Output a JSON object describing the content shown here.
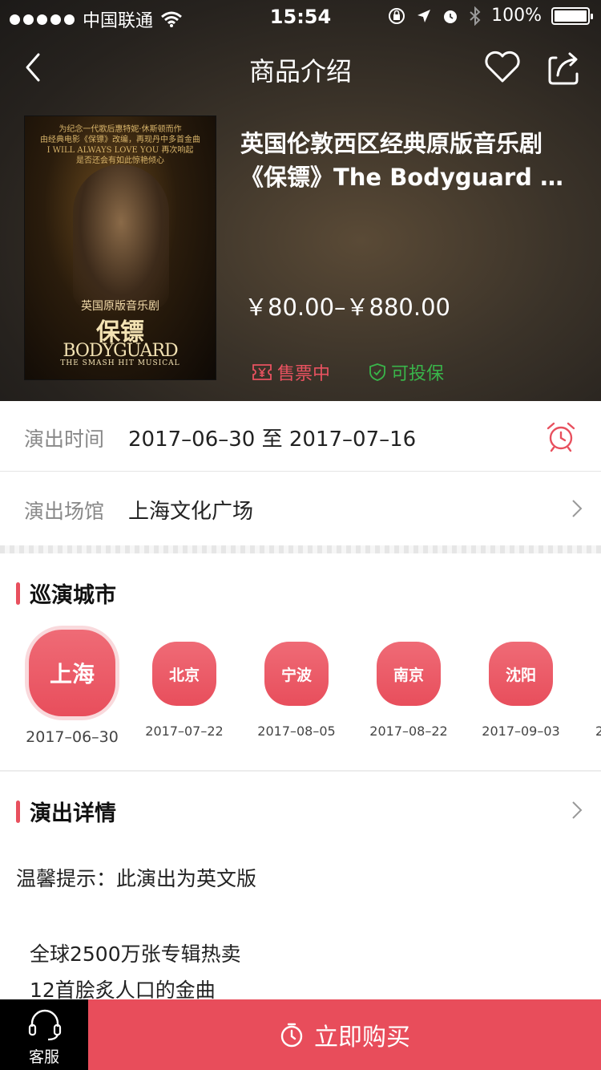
{
  "status_bar": {
    "carrier": "中国联通",
    "time": "15:54",
    "battery": "100%"
  },
  "nav": {
    "title": "商品介绍"
  },
  "poster": {
    "top_text_1": "为纪念一代歌后惠特妮·休斯顿而作",
    "top_text_2": "由经典电影《保镖》改编，再现丹中多首金曲",
    "top_text_3": "I WILL ALWAYS LOVE YOU 再次响起",
    "top_text_4": "是否还会有如此惊艳倾心",
    "subtitle": "英国原版音乐剧",
    "cn_title": "保镖",
    "en_title": "BODYGUARD",
    "en_sub": "THE SMASH HIT MUSICAL"
  },
  "product": {
    "title_line1": "英国伦敦西区经典原版音乐剧",
    "title_line2": "《保镖》The Bodyguard M...",
    "price": "￥80.00–￥880.00",
    "tag_sale": "售票中",
    "tag_insure": "可投保"
  },
  "info": {
    "time_label": "演出时间",
    "time_value": "2017–06–30 至 2017–07–16",
    "venue_label": "演出场馆",
    "venue_value": "上海文化广场"
  },
  "tour": {
    "title": "巡演城市",
    "cities": [
      {
        "name": "上海",
        "date": "2017–06–30"
      },
      {
        "name": "北京",
        "date": "2017–07–22"
      },
      {
        "name": "宁波",
        "date": "2017–08–05"
      },
      {
        "name": "南京",
        "date": "2017–08–22"
      },
      {
        "name": "沈阳",
        "date": "2017–09–03"
      }
    ],
    "partial_date": "2"
  },
  "details": {
    "title": "演出详情",
    "tip": "温馨提示：此演出为英文版",
    "line1": "全球2500万张专辑热卖",
    "line2": "12首脍炙人口的金曲"
  },
  "bottom": {
    "service_label": "客服",
    "buy_label": "立即购买"
  },
  "colors": {
    "accent": "#e84d5b",
    "insure_green": "#39b54a",
    "hero_bg": "#2e2923"
  }
}
